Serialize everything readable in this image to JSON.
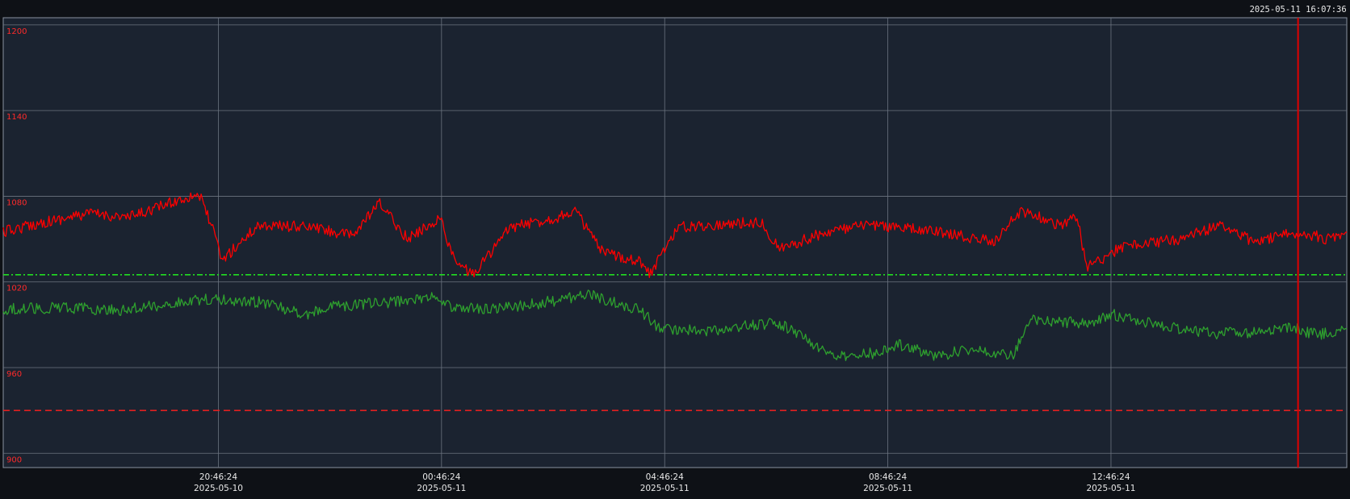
{
  "timestamp": "2025-05-11 16:07:36",
  "colors": {
    "background": "#1b2330",
    "grid": "#6c7480",
    "series_a": "#ff0000",
    "series_b": "#2ea02e",
    "ref_upper": "#22dd22",
    "ref_lower": "#e02020",
    "cursor": "#e00000"
  },
  "chart_data": {
    "type": "line",
    "title": "",
    "xlabel": "",
    "ylabel": "",
    "ylim": [
      890,
      1205
    ],
    "y_ticks": [
      {
        "value": 1200,
        "label": "1200"
      },
      {
        "value": 1140,
        "label": "1140"
      },
      {
        "value": 1080,
        "label": "1080"
      },
      {
        "value": 1020,
        "label": "1020"
      },
      {
        "value": 960,
        "label": "960"
      },
      {
        "value": 900,
        "label": "900"
      }
    ],
    "xlim": [
      "2025-05-10 16:55:00",
      "2025-05-11 17:00:00"
    ],
    "x_ticks": [
      {
        "value": "2025-05-10 20:46:24",
        "time": "20:46:24",
        "date": "2025-05-10"
      },
      {
        "value": "2025-05-11 00:46:24",
        "time": "00:46:24",
        "date": "2025-05-11"
      },
      {
        "value": "2025-05-11 04:46:24",
        "time": "04:46:24",
        "date": "2025-05-11"
      },
      {
        "value": "2025-05-11 08:46:24",
        "time": "08:46:24",
        "date": "2025-05-11"
      },
      {
        "value": "2025-05-11 12:46:24",
        "time": "12:46:24",
        "date": "2025-05-11"
      }
    ],
    "grid": true,
    "reference_lines": [
      {
        "value": 1025,
        "style": "dash-dot",
        "color": "#22dd22"
      },
      {
        "value": 930,
        "style": "dashed",
        "color": "#e02020"
      }
    ],
    "cursor_time": "2025-05-11 16:07:36",
    "series": [
      {
        "color": "#ff0000",
        "x": [
          "2025-05-10 16:55:00",
          "2025-05-10 17:40:00",
          "2025-05-10 18:30:00",
          "2025-05-10 19:10:00",
          "2025-05-10 19:40:00",
          "2025-05-10 20:25:00",
          "2025-05-10 20:39:00",
          "2025-05-10 20:50:00",
          "2025-05-10 21:30:00",
          "2025-05-10 22:30:00",
          "2025-05-10 23:10:00",
          "2025-05-10 23:40:00",
          "2025-05-11 00:10:00",
          "2025-05-11 00:45:00",
          "2025-05-11 01:00:00",
          "2025-05-11 01:20:00",
          "2025-05-11 02:00:00",
          "2025-05-11 02:50:00",
          "2025-05-11 03:10:00",
          "2025-05-11 03:40:00",
          "2025-05-11 04:20:00",
          "2025-05-11 04:30:00",
          "2025-05-11 05:00:00",
          "2025-05-11 05:40:00",
          "2025-05-11 06:30:00",
          "2025-05-11 06:50:00",
          "2025-05-11 07:40:00",
          "2025-05-11 08:30:00",
          "2025-05-11 09:40:00",
          "2025-05-11 10:40:00",
          "2025-05-11 11:10:00",
          "2025-05-11 11:50:00",
          "2025-05-11 12:10:00",
          "2025-05-11 12:20:00",
          "2025-05-11 13:00:00",
          "2025-05-11 14:00:00",
          "2025-05-11 14:45:00",
          "2025-05-11 15:20:00",
          "2025-05-11 16:10:00",
          "2025-05-11 16:40:00",
          "2025-05-11 17:00:00"
        ],
        "values": [
          1055,
          1062,
          1068,
          1065,
          1072,
          1082,
          1060,
          1035,
          1060,
          1058,
          1052,
          1075,
          1050,
          1065,
          1035,
          1025,
          1058,
          1065,
          1070,
          1040,
          1035,
          1025,
          1058,
          1060,
          1062,
          1043,
          1055,
          1060,
          1055,
          1048,
          1070,
          1060,
          1065,
          1030,
          1045,
          1050,
          1060,
          1048,
          1055,
          1050,
          1055
        ]
      },
      {
        "color": "#2ea02e",
        "x": [
          "2025-05-10 16:55:00",
          "2025-05-10 18:00:00",
          "2025-05-10 19:00:00",
          "2025-05-10 20:30:00",
          "2025-05-10 21:30:00",
          "2025-05-10 22:20:00",
          "2025-05-10 22:50:00",
          "2025-05-11 00:00:00",
          "2025-05-11 00:40:00",
          "2025-05-11 01:00:00",
          "2025-05-11 02:00:00",
          "2025-05-11 03:00:00",
          "2025-05-11 03:20:00",
          "2025-05-11 04:20:00",
          "2025-05-11 04:40:00",
          "2025-05-11 05:30:00",
          "2025-05-11 06:20:00",
          "2025-05-11 06:50:00",
          "2025-05-11 07:50:00",
          "2025-05-11 08:30:00",
          "2025-05-11 09:00:00",
          "2025-05-11 09:40:00",
          "2025-05-11 10:20:00",
          "2025-05-11 11:00:00",
          "2025-05-11 11:20:00",
          "2025-05-11 12:20:00",
          "2025-05-11 12:50:00",
          "2025-05-11 13:40:00",
          "2025-05-11 14:40:00",
          "2025-05-11 15:30:00",
          "2025-05-11 16:00:00",
          "2025-05-11 16:30:00",
          "2025-05-11 17:00:00"
        ],
        "values": [
          1001,
          1002,
          1000,
          1008,
          1006,
          997,
          1003,
          1006,
          1010,
          1001,
          1002,
          1008,
          1012,
          1000,
          988,
          985,
          990,
          991,
          967,
          970,
          976,
          968,
          974,
          968,
          993,
          991,
          997,
          989,
          984,
          985,
          988,
          983,
          987
        ]
      }
    ]
  }
}
